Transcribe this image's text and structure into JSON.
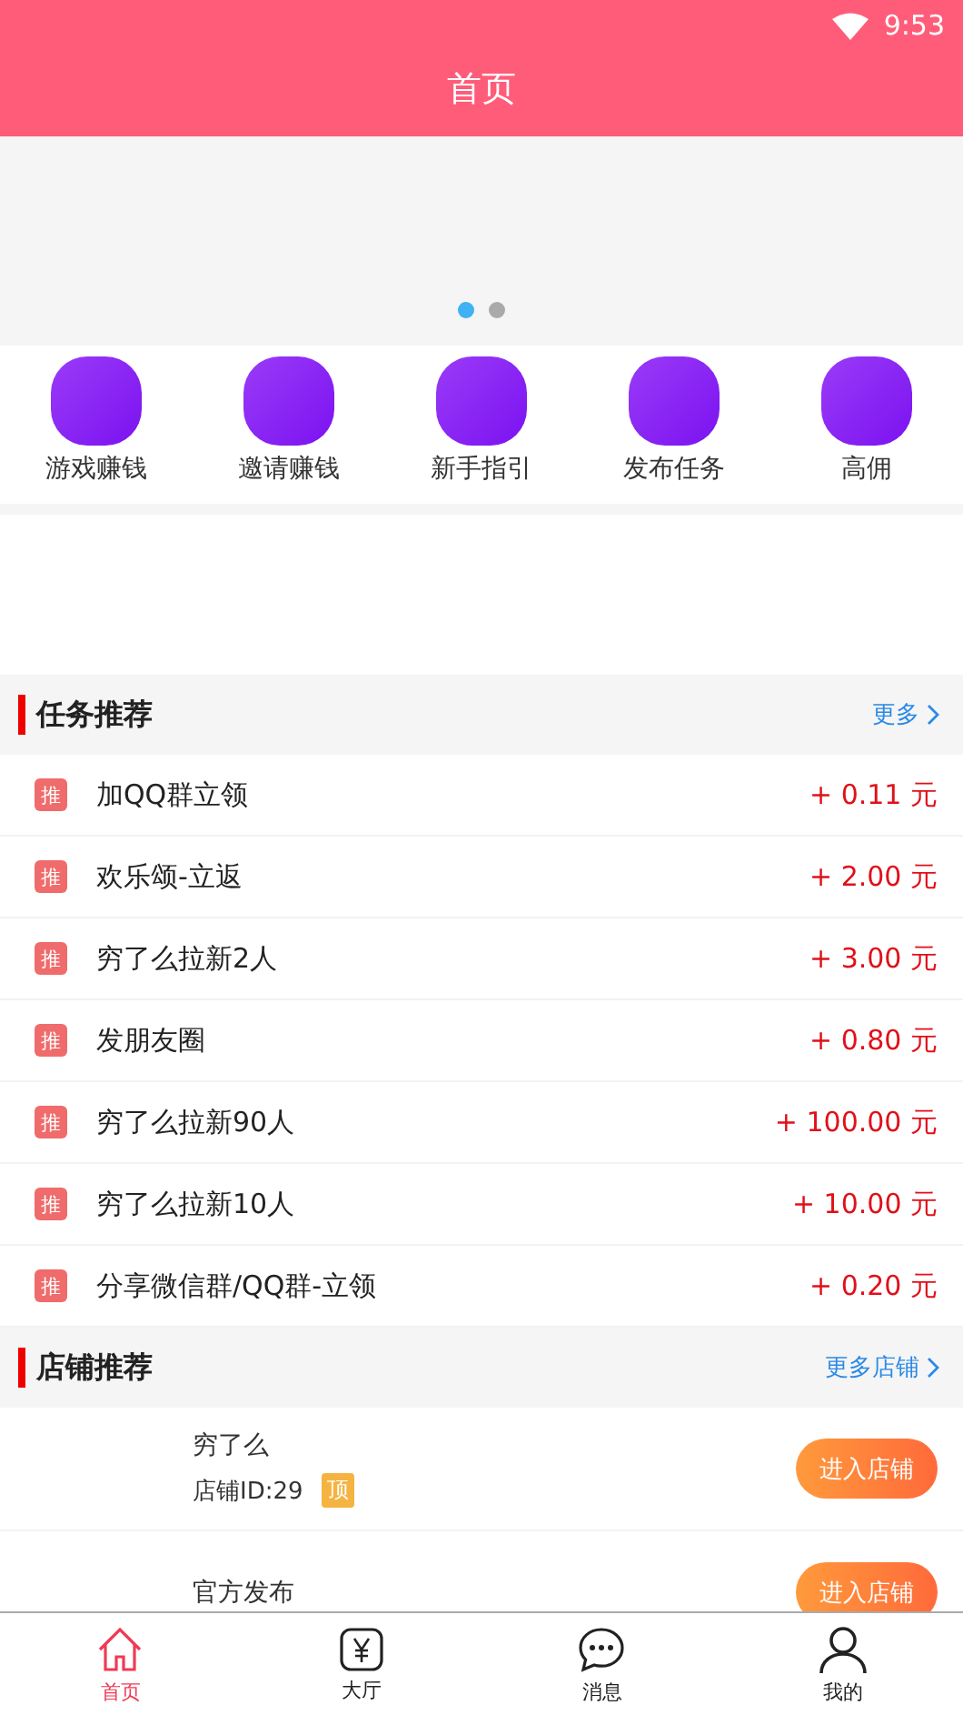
{
  "status_bar": {
    "time": "9:53"
  },
  "header": {
    "title": "首页"
  },
  "banner": {
    "dots": [
      {
        "selected": true
      },
      {
        "selected": false
      }
    ]
  },
  "shortcuts": [
    {
      "label": "游戏赚钱"
    },
    {
      "label": "邀请赚钱"
    },
    {
      "label": "新手指引"
    },
    {
      "label": "发布任务"
    },
    {
      "label": "高佣"
    }
  ],
  "task_section": {
    "title": "任务推荐",
    "more": "更多"
  },
  "tasks": [
    {
      "tag": "推",
      "title": "加QQ群立领",
      "reward": "+ 0.11 元"
    },
    {
      "tag": "推",
      "title": "欢乐颂-立返",
      "reward": "+ 2.00 元"
    },
    {
      "tag": "推",
      "title": "穷了么拉新2人",
      "reward": "+ 3.00 元"
    },
    {
      "tag": "推",
      "title": "发朋友圈",
      "reward": "+ 0.80 元"
    },
    {
      "tag": "推",
      "title": "穷了么拉新90人",
      "reward": "+ 100.00 元"
    },
    {
      "tag": "推",
      "title": "穷了么拉新10人",
      "reward": "+ 10.00 元"
    },
    {
      "tag": "推",
      "title": "分享微信群/QQ群-立领",
      "reward": "+ 0.20 元"
    }
  ],
  "shop_section": {
    "title": "店铺推荐",
    "more": "更多店铺"
  },
  "shops": [
    {
      "name": "穷了么",
      "shop_id": "店铺ID:29",
      "badge": "顶",
      "button": "进入店铺"
    },
    {
      "name": "官方发布",
      "button": "进入店铺"
    }
  ],
  "tab_bar": [
    {
      "label": "首页",
      "kind": "home",
      "selected": true
    },
    {
      "label": "大厅",
      "kind": "hall",
      "selected": false
    },
    {
      "label": "消息",
      "kind": "messages",
      "selected": false
    },
    {
      "label": "我的",
      "kind": "profile",
      "selected": false
    }
  ]
}
